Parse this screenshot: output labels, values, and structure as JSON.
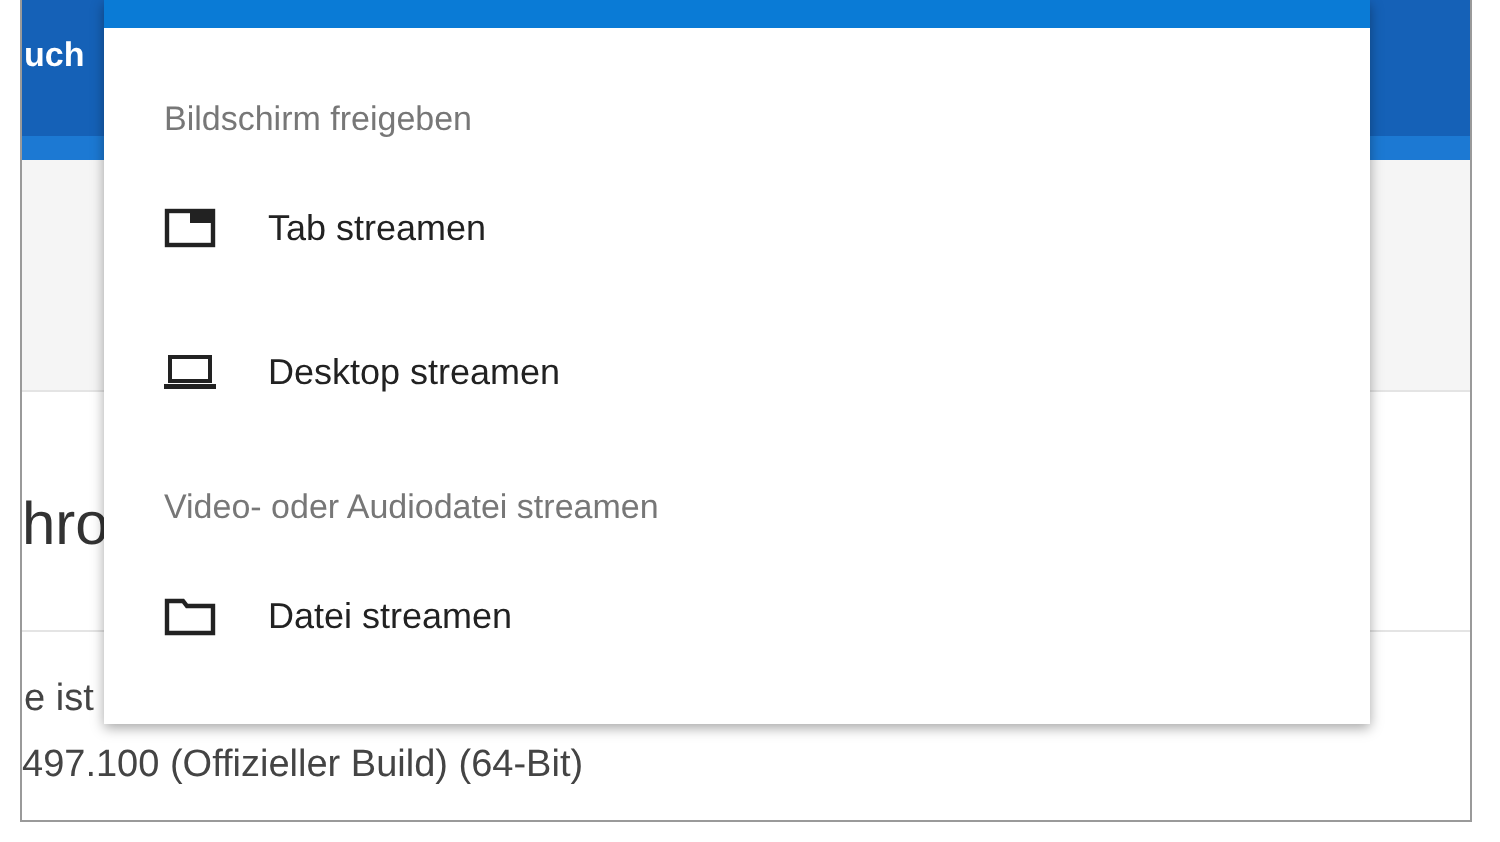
{
  "page": {
    "header_text": "uch",
    "heading": "hro",
    "line_1": "e ist",
    "line_2": "497.100 (Offizieller Build) (64-Bit)"
  },
  "cast_menu": {
    "sections": [
      {
        "title": "Bildschirm freigeben",
        "items": [
          {
            "label": "Tab streamen",
            "kind": "tab"
          },
          {
            "label": "Desktop streamen",
            "kind": "desktop"
          }
        ]
      },
      {
        "title": "Video- oder Audiodatei streamen",
        "items": [
          {
            "label": "Datei streamen",
            "kind": "file"
          }
        ]
      }
    ]
  }
}
